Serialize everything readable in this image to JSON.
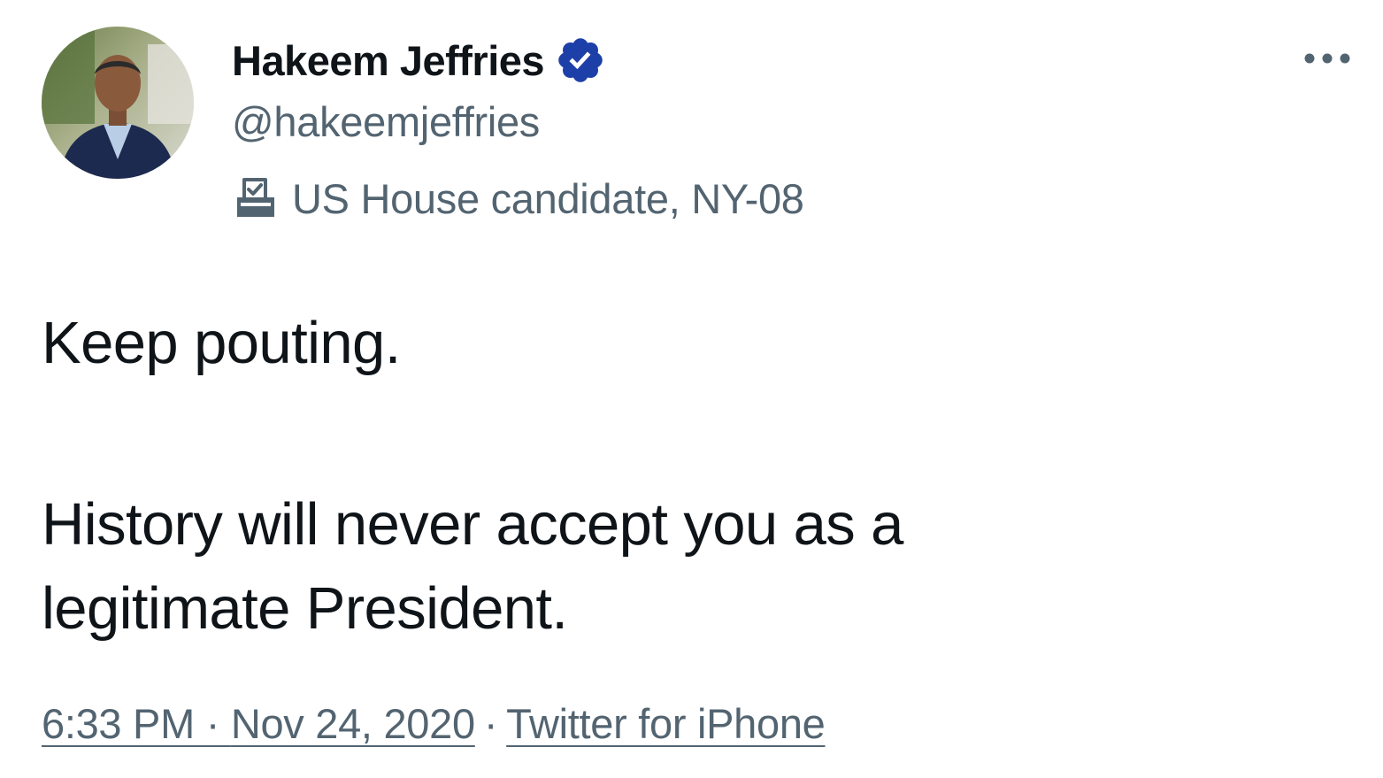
{
  "author": {
    "display_name": "Hakeem Jeffries",
    "handle": "@hakeemjeffries",
    "verified": true,
    "label_icon": "ballot-box-icon",
    "label_text": "US House candidate, NY-08"
  },
  "tweet": {
    "paragraph_1": "Keep pouting.",
    "paragraph_2": "History will never accept you as a legitimate President."
  },
  "meta": {
    "time": "6:33 PM",
    "date": "Nov 24, 2020",
    "separator": "·",
    "source": "Twitter for iPhone"
  },
  "colors": {
    "text_primary": "#0f1419",
    "text_secondary": "#536471",
    "verified_badge": "#1d3fa8",
    "background": "#ffffff"
  },
  "icons": {
    "more": "more-horizontal-icon",
    "verified": "verified-badge-icon",
    "label": "ballot-box-icon"
  }
}
